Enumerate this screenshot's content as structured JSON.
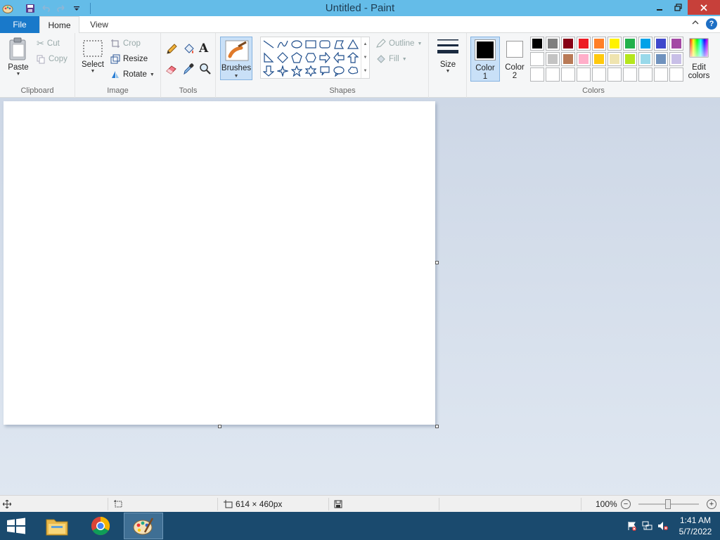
{
  "window": {
    "title": "Untitled - Paint"
  },
  "tabs": {
    "file": "File",
    "home": "Home",
    "view": "View"
  },
  "help": "?",
  "clipboard": {
    "paste": "Paste",
    "cut": "Cut",
    "copy": "Copy",
    "label": "Clipboard"
  },
  "image": {
    "select": "Select",
    "crop": "Crop",
    "resize": "Resize",
    "rotate": "Rotate",
    "label": "Image"
  },
  "tools": {
    "label": "Tools"
  },
  "brushes": {
    "label": "Brushes"
  },
  "shapes": {
    "label": "Shapes",
    "outline": "Outline",
    "fill": "Fill"
  },
  "size": {
    "label": "Size"
  },
  "colors": {
    "color1_line1": "Color",
    "color1_line2": "1",
    "color2_line1": "Color",
    "color2_line2": "2",
    "edit_line1": "Edit",
    "edit_line2": "colors",
    "label": "Colors",
    "color1_value": "#000000",
    "color2_value": "#ffffff",
    "palette_row1": [
      "#000000",
      "#7f7f7f",
      "#880015",
      "#ed1c24",
      "#ff7f27",
      "#fff200",
      "#22b14c",
      "#00a2e8",
      "#3f48cc",
      "#a349a4"
    ],
    "palette_row2": [
      "#ffffff",
      "#c3c3c3",
      "#b97a57",
      "#ffaec9",
      "#ffc90e",
      "#efe4b0",
      "#b5e61d",
      "#99d9ea",
      "#7092be",
      "#c8bfe7"
    ],
    "palette_row3": [
      "",
      "",
      "",
      "",
      "",
      "",
      "",
      "",
      "",
      ""
    ]
  },
  "statusbar": {
    "canvas_size": "614 × 460px",
    "zoom": "100%",
    "zoom_level": 1.0
  },
  "taskbar": {
    "time": "1:41 AM",
    "date": "5/7/2022"
  }
}
